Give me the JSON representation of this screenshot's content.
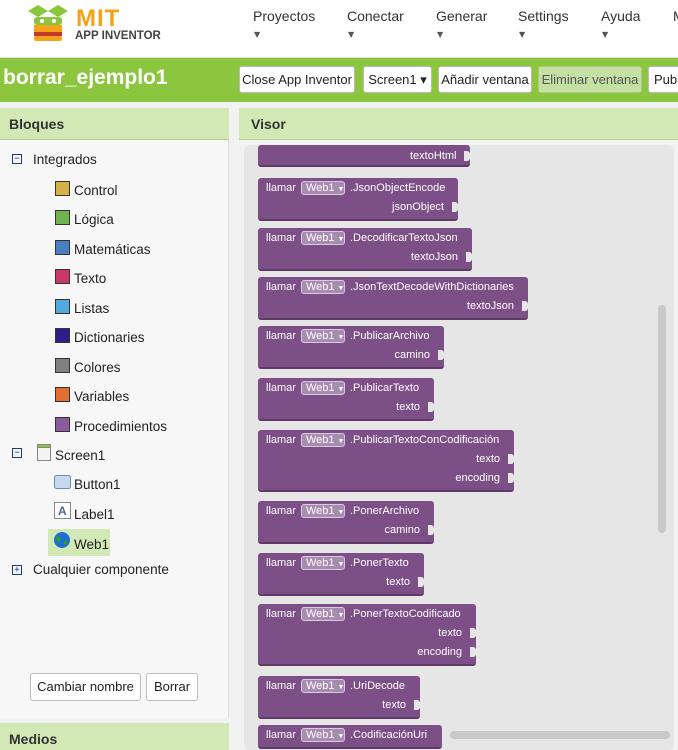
{
  "brand": {
    "mit": "MIT",
    "sub": "APP INVENTOR"
  },
  "nav": [
    {
      "label": "Proyectos"
    },
    {
      "label": "Conectar"
    },
    {
      "label": "Generar"
    },
    {
      "label": "Settings"
    },
    {
      "label": "Ayuda"
    },
    {
      "label": "M"
    }
  ],
  "project": {
    "name": "borrar_ejemplo1",
    "close_label": "Close App Inventor",
    "screen_label": "Screen1 ▾",
    "add_screen_label": "Añadir ventana",
    "remove_screen_label": "Eliminar ventana",
    "publish_label": "Publi"
  },
  "blocks_panel": {
    "title": "Bloques",
    "builtin_label": "Integrados",
    "categories": [
      {
        "label": "Control",
        "color": "#d4b04a"
      },
      {
        "label": "Lógica",
        "color": "#6fb24e"
      },
      {
        "label": "Matemáticas",
        "color": "#4a7fc1"
      },
      {
        "label": "Texto",
        "color": "#c9386a"
      },
      {
        "label": "Listas",
        "color": "#54a8de"
      },
      {
        "label": "Dictionaries",
        "color": "#2d1d8a"
      },
      {
        "label": "Colores",
        "color": "#808080"
      },
      {
        "label": "Variables",
        "color": "#e26d35"
      },
      {
        "label": "Procedimientos",
        "color": "#8a5c9b"
      }
    ],
    "screen_label": "Screen1",
    "components": [
      {
        "label": "Button1"
      },
      {
        "label": "Label1"
      },
      {
        "label": "Web1"
      }
    ],
    "any_component_label": "Cualquier componente",
    "rename_label": "Cambiar nombre",
    "delete_label": "Borrar"
  },
  "media_panel": {
    "title": "Medios"
  },
  "viewer": {
    "title": "Visor",
    "partial_top_param": "textoHtml",
    "call_label": "llamar",
    "component": "Web1",
    "blocks": [
      {
        "method": ".JsonObjectEncode",
        "params": [
          "jsonObject"
        ]
      },
      {
        "method": ".DecodificarTextoJson",
        "params": [
          "textoJson"
        ]
      },
      {
        "method": ".JsonTextDecodeWithDictionaries",
        "params": [
          "textoJson"
        ]
      },
      {
        "method": ".PublicarArchivo",
        "params": [
          "camino"
        ]
      },
      {
        "method": ".PublicarTexto",
        "params": [
          "texto"
        ]
      },
      {
        "method": ".PublicarTextoConCodificación",
        "params": [
          "texto",
          "encoding"
        ]
      },
      {
        "method": ".PonerArchivo",
        "params": [
          "camino"
        ]
      },
      {
        "method": ".PonerTexto",
        "params": [
          "texto"
        ]
      },
      {
        "method": ".PonerTextoCodificado",
        "params": [
          "texto",
          "encoding"
        ]
      },
      {
        "method": ".UriDecode",
        "params": [
          "texto"
        ]
      },
      {
        "method": ".CodificaciónUri",
        "params": []
      }
    ]
  }
}
